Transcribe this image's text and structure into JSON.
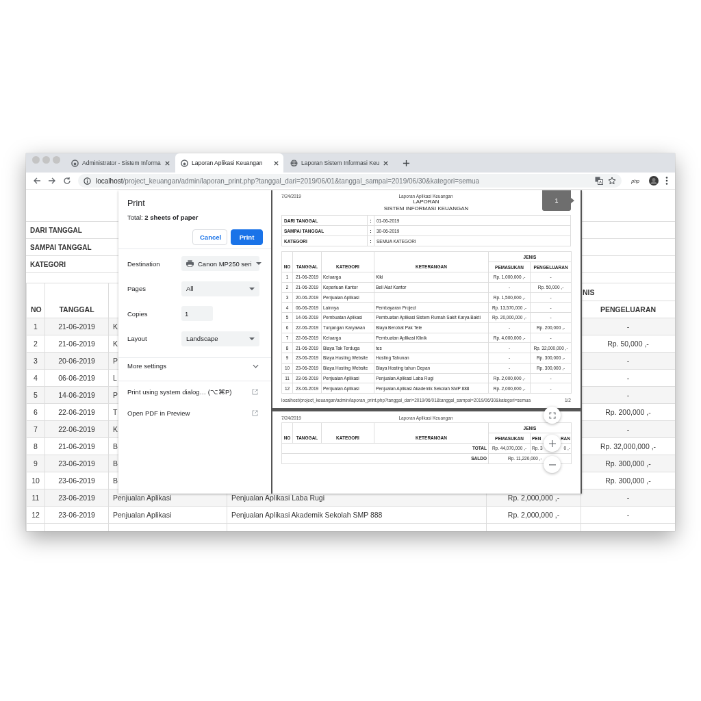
{
  "browser": {
    "tabs": [
      {
        "title": "Administrator - Sistem Informa",
        "kind": "site",
        "selected": false
      },
      {
        "title": "Laporan Aplikasi Keuangan",
        "kind": "site",
        "selected": true
      },
      {
        "title": "Laporan Sistem Informasi Keu",
        "kind": "globe",
        "selected": false
      }
    ],
    "url_host": "localhost",
    "url_path": "/project_keuangan/admin/laporan_print.php?tanggal_dari=2019/06/01&tanggal_sampai=2019/06/30&kategori=semua",
    "extension_label": "php"
  },
  "page": {
    "info_labels": [
      "DARI TANGGAL",
      "SAMPAI TANGGAL",
      "KATEGORI"
    ],
    "table": {
      "group_header": "NIS",
      "columns": [
        "NO",
        "TANGGAL",
        "PENGELUARAN"
      ],
      "rows": [
        {
          "no": "1",
          "tanggal": "21-06-2019",
          "kategori": "K",
          "pengeluaran": "-"
        },
        {
          "no": "2",
          "tanggal": "21-06-2019",
          "kategori": "K",
          "pengeluaran": "Rp. 50,000 ,-"
        },
        {
          "no": "3",
          "tanggal": "20-06-2019",
          "kategori": "P",
          "pengeluaran": "-"
        },
        {
          "no": "4",
          "tanggal": "06-06-2019",
          "kategori": "L",
          "pengeluaran": "-"
        },
        {
          "no": "5",
          "tanggal": "14-06-2019",
          "kategori": "P",
          "pengeluaran": "-"
        },
        {
          "no": "6",
          "tanggal": "22-06-2019",
          "kategori": "T",
          "pengeluaran": "Rp. 200,000 ,-"
        },
        {
          "no": "7",
          "tanggal": "22-06-2019",
          "kategori": "K",
          "pengeluaran": "-"
        },
        {
          "no": "8",
          "tanggal": "21-06-2019",
          "kategori": "B",
          "pengeluaran": "Rp. 32,000,000 ,-"
        },
        {
          "no": "9",
          "tanggal": "23-06-2019",
          "kategori": "B",
          "pengeluaran": "Rp. 300,000 ,-"
        },
        {
          "no": "10",
          "tanggal": "23-06-2019",
          "kategori": "B",
          "pengeluaran": "Rp. 300,000 ,-"
        },
        {
          "no": "11",
          "tanggal": "23-06-2019",
          "kategori": "Penjualan Aplikasi",
          "keterangan": "Penjualan Aplikasi Laba Rugi",
          "pemasukan": "Rp. 2,000,000 ,-",
          "pengeluaran": "-"
        },
        {
          "no": "12",
          "tanggal": "23-06-2019",
          "kategori": "Penjualan Aplikasi",
          "keterangan": "Penjualan Aplikasi Akademik Sekolah SMP 888",
          "pemasukan": "Rp. 2,000,000 ,-",
          "pengeluaran": "-"
        }
      ]
    }
  },
  "print_dialog": {
    "title": "Print",
    "total": "Total: **2 sheets of paper**",
    "buttons": [
      {
        "label": "Cancel",
        "kind": "secondary"
      },
      {
        "label": "Print",
        "kind": "primary"
      }
    ],
    "settings": [
      {
        "label": "Destination",
        "kind": "device",
        "value": "Canon MP250 seri"
      },
      {
        "label": "Pages",
        "kind": "select",
        "value": "All"
      },
      {
        "label": "Copies",
        "kind": "number",
        "value": "1"
      },
      {
        "label": "Layout",
        "kind": "select",
        "value": "Landscape"
      }
    ],
    "more_settings": {
      "label": "More settings",
      "expanded": false
    },
    "links": [
      "Print using system dialog… (⌥⌘P)",
      "Open PDF in Preview"
    ]
  },
  "preview": {
    "page_badge": "1",
    "page_1": {
      "header_date": "7/24/2019",
      "header_title": "Laporan Aplikasi Keuangan",
      "report_title": "LAPORAN",
      "report_subtitle": "SISTEM INFORMASI KEUANGAN",
      "info": [
        {
          "label": "DARI TANGGAL",
          "separator": ":",
          "value": "01-06-2019"
        },
        {
          "label": "SAMPAI TANGGAL",
          "separator": ":",
          "value": "30-06-2019"
        },
        {
          "label": "KATEGORI",
          "separator": ":",
          "value": "SEMUA KATEGORI"
        }
      ],
      "group_header": "JENIS",
      "columns": [
        "NO",
        "TANGGAL",
        "KATEGORI",
        "KETERANGAN",
        "PEMASUKAN",
        "PENGELUARAN"
      ],
      "rows": [
        {
          "no": "1",
          "tanggal": "21-06-2019",
          "kategori": "Keluarga",
          "keterangan": "Kiki",
          "pemasukan": "Rp. 1,000,000 ,-",
          "pengeluaran": "-"
        },
        {
          "no": "2",
          "tanggal": "21-06-2019",
          "kategori": "Keperluan Kantor",
          "keterangan": "Beli Alat Kantor",
          "pemasukan": "-",
          "pengeluaran": "Rp. 50,000 ,-"
        },
        {
          "no": "3",
          "tanggal": "20-06-2019",
          "kategori": "Penjualan Aplikasi",
          "pemasukan": "Rp. 1,500,000 ,-",
          "pengeluaran": "-"
        },
        {
          "no": "4",
          "tanggal": "06-06-2019",
          "kategori": "Lainnya",
          "keterangan": "Pembayaran Project",
          "pemasukan": "Rp. 13,570,000 ,-",
          "pengeluaran": "-"
        },
        {
          "no": "5",
          "tanggal": "14-06-2019",
          "kategori": "Pembuatan Aplikasi",
          "keterangan": "Pembuatan Aplikasi Sistem Rumah Sakit Karya Bakti",
          "pemasukan": "Rp. 20,000,000 ,-",
          "pengeluaran": "-"
        },
        {
          "no": "6",
          "tanggal": "22-06-2019",
          "kategori": "Tunjangan Karyawan",
          "keterangan": "Biaya Berobat Pak Tele",
          "pemasukan": "-",
          "pengeluaran": "Rp. 200,000 ,-"
        },
        {
          "no": "7",
          "tanggal": "22-06-2019",
          "kategori": "Keluarga",
          "keterangan": "Pembuatan Aplikasi Klinik",
          "pemasukan": "Rp. 4,000,000 ,-",
          "pengeluaran": "-"
        },
        {
          "no": "8",
          "tanggal": "21-06-2019",
          "kategori": "Biaya Tak Terduga",
          "keterangan": "tes",
          "pemasukan": "-",
          "pengeluaran": "Rp. 32,000,000 ,-"
        },
        {
          "no": "9",
          "tanggal": "23-06-2019",
          "kategori": "Biaya Hosting Website",
          "keterangan": "Hosting Tahunan",
          "pemasukan": "-",
          "pengeluaran": "Rp. 300,000 ,-"
        },
        {
          "no": "10",
          "tanggal": "23-06-2019",
          "kategori": "Biaya Hosting Website",
          "keterangan": "Biaya Hosting tahun Depan",
          "pemasukan": "-",
          "pengeluaran": "Rp. 300,000 ,-"
        },
        {
          "no": "11",
          "tanggal": "23-06-2019",
          "kategori": "Penjualan Aplikasi",
          "keterangan": "Penjualan Aplikasi Laba Rugi",
          "pemasukan": "Rp. 2,000,000 ,-",
          "pengeluaran": "-"
        },
        {
          "no": "12",
          "tanggal": "23-06-2019",
          "kategori": "Penjualan Aplikasi",
          "keterangan": "Penjualan Aplikasi Akademik Sekolah SMP 888",
          "pemasukan": "Rp. 2,000,000 ,-",
          "pengeluaran": "-"
        }
      ],
      "footer_url": "localhost/project_keuangan/admin/laporan_print.php?tanggal_dari=2019/06/01&tanggal_sampai=2019/06/30&kategori=semua",
      "footer_page": "1/2"
    },
    "page_2": {
      "header_date": "7/24/2019",
      "header_title": "Laporan Aplikasi Keuangan",
      "group_header": "JENIS",
      "columns": [
        "NO",
        "TANGGAL",
        "KATEGORI",
        "KETERANGAN",
        "PEMASUKAN"
      ],
      "last_column_parts": [
        "PEN",
        "RAN"
      ],
      "total": {
        "label": "TOTAL",
        "pemasukan": "Rp. 44,070,000 ,-",
        "pengeluaran_parts": [
          "Rp. 3",
          "0 ,-"
        ]
      },
      "saldo": {
        "label": "SALDO",
        "value": "Rp. 11,220,000 ,-"
      }
    }
  }
}
